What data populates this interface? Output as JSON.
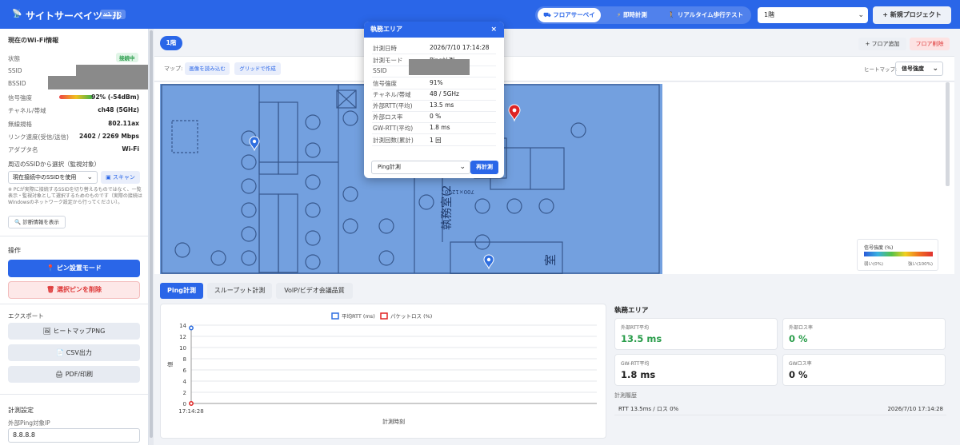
{
  "header": {
    "logo_glyph": "📡",
    "title": "サイトサーベイツール",
    "version": "v1.2.0",
    "modes": [
      {
        "label": "フロアサーベイ",
        "active": true
      },
      {
        "label": "即時計測",
        "active": false
      },
      {
        "label": "リアルタイム歩行テスト",
        "active": false
      }
    ],
    "floor_select": "1階",
    "new_project": "+ 新規プロジェクト"
  },
  "sidebar": {
    "wifi_heading": "現在のWi-Fi情報",
    "rows": [
      {
        "label": "状態",
        "value": "接続中"
      },
      {
        "label": "SSID",
        "value": ""
      },
      {
        "label": "BSSID",
        "value": ""
      },
      {
        "label": "信号強度",
        "value": "92% (-54dBm)"
      },
      {
        "label": "チャネル/帯域",
        "value": "ch48 (5GHz)"
      },
      {
        "label": "無線規格",
        "value": "802.11ax"
      },
      {
        "label": "リンク速度(受信/送信)",
        "value": "2402 / 2269 Mbps"
      },
      {
        "label": "アダプタ名",
        "value": "Wi-Fi"
      }
    ],
    "signal_percent": 92,
    "nearby_label": "周辺のSSIDから選択（監視対象）",
    "ssid_select": "現在接続中のSSIDを使用",
    "scan_button": "スキャン",
    "note": "※ PCが実際に接続するSSIDを切り替えるものではなく、一覧表示・監視対象として選択するためのものです（実際の接続はWindowsのネットワーク設定から行ってください）。",
    "diag_button": "診断情報を表示",
    "ops_heading": "操作",
    "pin_mode_button": "ピン設置モード",
    "delete_pin_button": "選択ピンを削除",
    "export_heading": "エクスポート",
    "export_heatmap": "ヒートマップPNG",
    "export_csv": "CSV出力",
    "export_pdf": "PDF/印刷",
    "measure_heading": "計測設定",
    "ping_target_label": "外部Ping対象IP",
    "ping_target_value": "8.8.8.8"
  },
  "main": {
    "floor_tab": "1階",
    "add_floor": "+ フロア追加",
    "delete_floor": "フロア削除",
    "map_label": "マップ:",
    "load_image": "画像を読み込む",
    "grid_create": "グリッドで作成",
    "heatmap_label": "ヒートマップ:",
    "heatmap_select": "信号強度",
    "plan_text_1": "執務室(2",
    "plan_text_2": "700×1200",
    "plan_text_3": "室",
    "legend_title": "信号強度 (%)",
    "legend_low": "弱い(0%)",
    "legend_high": "強い(100%)",
    "tabs": [
      "Ping計測",
      "スループット計測",
      "VoIP/ビデオ会議品質"
    ],
    "pin_colors": {
      "normal": "#2f6fe0",
      "selected": "#e02424"
    }
  },
  "popup": {
    "title": "執務エリア",
    "close": "×",
    "rows": [
      {
        "label": "計測日時",
        "value": "2026/7/10 17:14:28"
      },
      {
        "label": "計測モード",
        "value": "Ping計測"
      },
      {
        "label": "SSID",
        "value": ""
      },
      {
        "label": "信号強度",
        "value": "91%"
      },
      {
        "label": "チャネル/帯域",
        "value": "48 / 5GHz"
      },
      {
        "label": "外部RTT(平均)",
        "value": "13.5 ms"
      },
      {
        "label": "外部ロス率",
        "value": "0 %"
      },
      {
        "label": "GW-RTT(平均)",
        "value": "1.8 ms"
      },
      {
        "label": "計測回数(累計)",
        "value": "1 回"
      }
    ],
    "mode_select": "Ping計測",
    "remeasure": "再計測"
  },
  "stats": {
    "heading": "執務エリア",
    "cards": [
      {
        "label": "外部RTT平均",
        "value": "13.5 ms",
        "color": "#2a9d4b"
      },
      {
        "label": "外部ロス率",
        "value": "0 %",
        "color": "#2a9d4b"
      },
      {
        "label": "GW-RTT平均",
        "value": "1.8 ms",
        "color": "#222222"
      },
      {
        "label": "GWロス率",
        "value": "0 %",
        "color": "#222222"
      }
    ],
    "history_label": "計測履歴",
    "history": [
      {
        "text": "RTT 13.5ms / ロス 0%",
        "time": "2026/7/10 17:14:28"
      }
    ]
  },
  "chart_data": {
    "type": "line",
    "x": [
      "17:14:28"
    ],
    "series": [
      {
        "name": "平均RTT (ms)",
        "values": [
          13.5
        ],
        "color": "#2f6fe0"
      },
      {
        "name": "パケットロス (%)",
        "values": [
          0
        ],
        "color": "#e02424"
      }
    ],
    "xlabel": "計測時刻",
    "ylabel": "値",
    "ylim": [
      0,
      14
    ],
    "yticks": [
      0,
      2,
      4,
      6,
      8,
      10,
      12,
      14
    ],
    "grid": true,
    "legend": "top"
  }
}
